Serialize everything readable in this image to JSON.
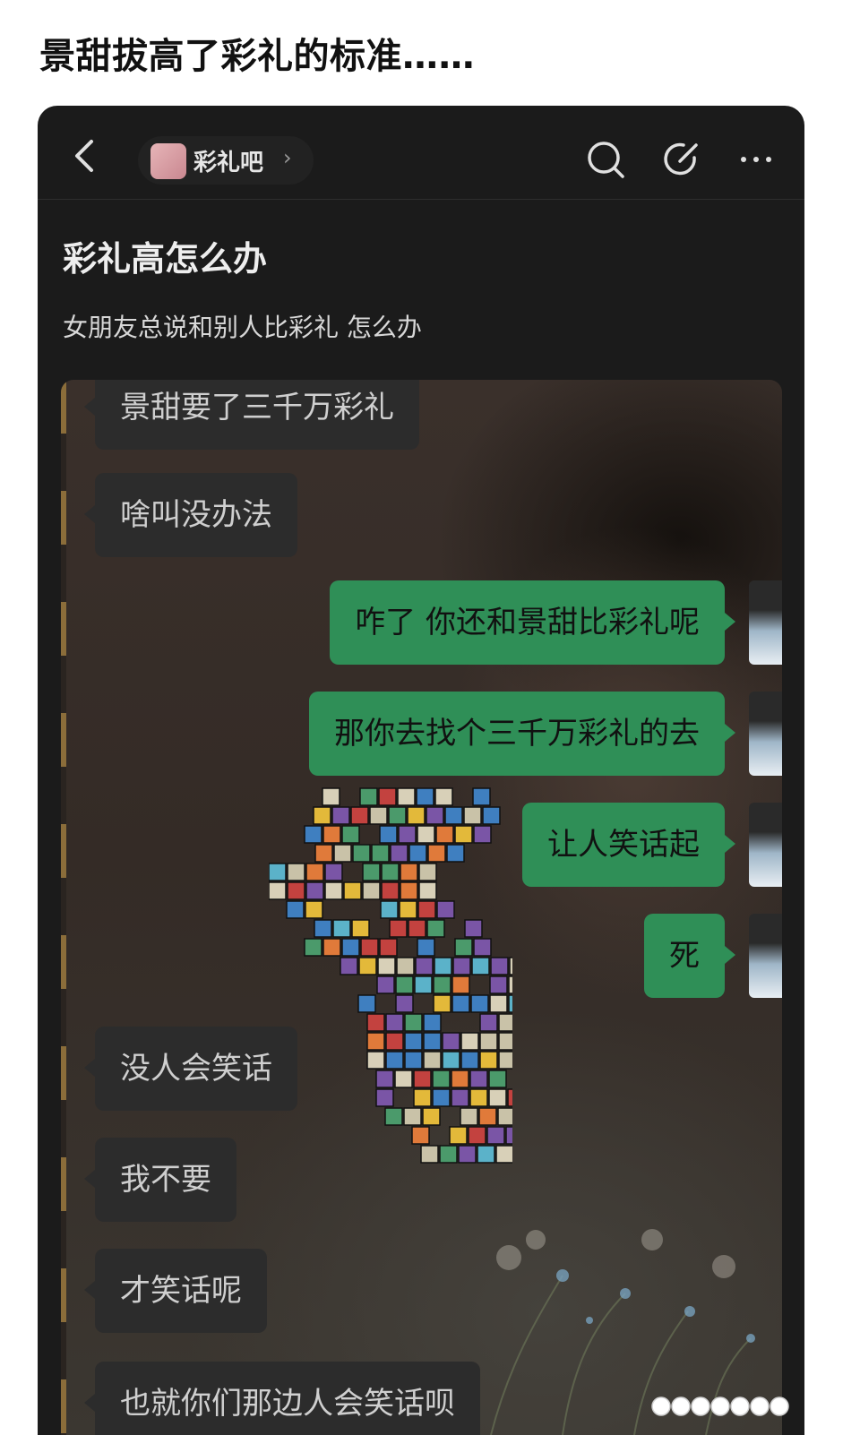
{
  "post_title": "景甜拔高了彩礼的标准……",
  "nav": {
    "forum_name": "彩礼吧",
    "forum_chevron": "›"
  },
  "thread": {
    "heading": "彩礼高怎么办",
    "body": "女朋友总说和别人比彩礼 怎么办"
  },
  "chat": {
    "messages": [
      {
        "side": "in",
        "text": "景甜要了三千万彩礼"
      },
      {
        "side": "in",
        "text": "啥叫没办法"
      },
      {
        "side": "out",
        "text": "咋了  你还和景甜比彩礼呢"
      },
      {
        "side": "out",
        "text": "那你去找个三千万彩礼的去"
      },
      {
        "side": "out",
        "text": "让人笑话起"
      },
      {
        "side": "out",
        "text": "死"
      },
      {
        "side": "in",
        "text": "没人会笑话"
      },
      {
        "side": "in",
        "text": "我不要"
      },
      {
        "side": "in",
        "text": "才笑话呢"
      },
      {
        "side": "in",
        "text": "也就你们那边人会笑话呗"
      }
    ]
  },
  "colors": {
    "outgoing_bubble": "#2f8f57",
    "incoming_bubble": "#2c2c2c",
    "app_background": "#1b1b1b"
  },
  "icons": [
    "back-icon",
    "search-icon",
    "edit-icon",
    "more-icon"
  ]
}
